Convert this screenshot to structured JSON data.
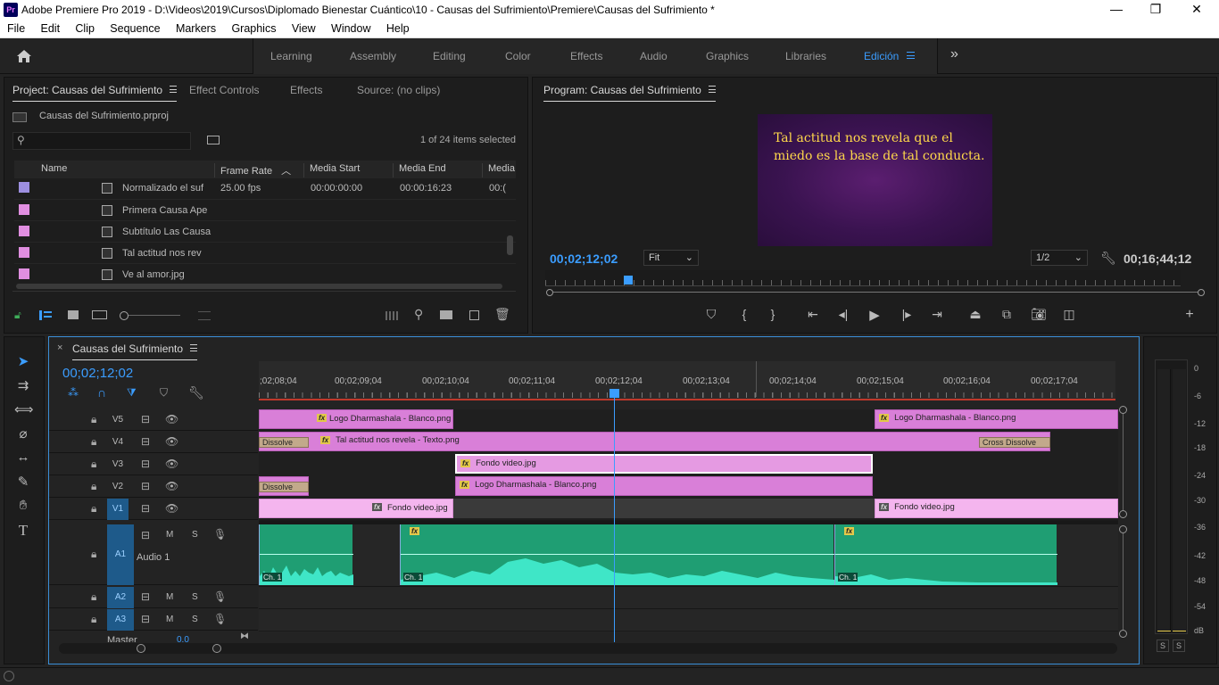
{
  "window": {
    "title": "Adobe Premiere Pro 2019 - D:\\Videos\\2019\\Cursos\\Diplomado Bienestar Cuántico\\10 - Causas del Sufrimiento\\Premiere\\Causas del Sufrimiento *",
    "logo": "Pr",
    "controls": [
      "—",
      "❐",
      "✕"
    ]
  },
  "menu": [
    "File",
    "Edit",
    "Clip",
    "Sequence",
    "Markers",
    "Graphics",
    "View",
    "Window",
    "Help"
  ],
  "workspaces": [
    "Learning",
    "Assembly",
    "Editing",
    "Color",
    "Effects",
    "Audio",
    "Graphics",
    "Libraries",
    "Edición"
  ],
  "workspace_more": "»",
  "project_panel": {
    "tabs": [
      "Project: Causas del Sufrimiento",
      "Effect Controls",
      "Effects",
      "Source: (no clips)"
    ],
    "file": "Causas del Sufrimiento.prproj",
    "search_placeholder": "",
    "items_selected": "1 of 24 items selected",
    "columns": [
      "Name",
      "Frame Rate",
      "Media Start",
      "Media End",
      "Media"
    ],
    "rows": [
      {
        "name": "Normalizado el suf",
        "frame_rate": "25.00 fps",
        "media_start": "00:00:00:00",
        "media_end": "00:00:16:23",
        "media": "00:(",
        "color": "#9d8fe0"
      },
      {
        "name": "Primera Causa Ape",
        "frame_rate": "",
        "media_start": "",
        "media_end": "",
        "media": "",
        "color": "#e08ee0"
      },
      {
        "name": "Subtítulo Las Causa",
        "frame_rate": "",
        "media_start": "",
        "media_end": "",
        "media": "",
        "color": "#e08ee0"
      },
      {
        "name": "Tal actitud nos rev",
        "frame_rate": "",
        "media_start": "",
        "media_end": "",
        "media": "",
        "color": "#e08ee0"
      },
      {
        "name": "Ve al amor.jpg",
        "frame_rate": "",
        "media_start": "",
        "media_end": "",
        "media": "",
        "color": "#e08ee0"
      }
    ]
  },
  "program_monitor": {
    "title": "Program: Causas del Sufrimiento",
    "frame_text": "Tal actitud nos revela que el miedo es la base de tal conducta.",
    "current_tc": "00;02;12;02",
    "duration_tc": "00;16;44;12",
    "zoom": "Fit",
    "resolution": "1/2",
    "playhead_fraction": 0.13
  },
  "timeline": {
    "title": "Causas del Sufrimiento",
    "timecode": "00;02;12;02",
    "ruler": ";02;08;04",
    "ruler_ticks": [
      "00;02;09;04",
      "00;02;10;04",
      "00;02;11;04",
      "00;02;12;04",
      "00;02;13;04",
      "00;02;14;04",
      "00;02;15;04",
      "00;02;16;04",
      "00;02;17;04"
    ],
    "video_tracks": [
      "V5",
      "V4",
      "V3",
      "V2",
      "V1"
    ],
    "audio_tracks": [
      {
        "id": "A1",
        "name": "Audio 1"
      },
      {
        "id": "A2",
        "name": ""
      },
      {
        "id": "A3",
        "name": ""
      }
    ],
    "master": {
      "label": "Master",
      "value": "0.0"
    },
    "track_buttons": {
      "mute": "M",
      "solo": "S"
    },
    "clips": {
      "v5a": "Logo Dharmashala - Blanco.png",
      "v5b": "Logo Dharmashala - Blanco.png",
      "v4_trans_a": "Dissolve",
      "v4": "Tal actitud nos revela - Texto.png",
      "v4_trans_b": "Cross Dissolve",
      "v3": "Fondo video.jpg",
      "v2_trans": "Dissolve",
      "v2": "Logo Dharmashala - Blanco.png",
      "v1a": "Fondo video.jpg",
      "v1b": "Fondo video.jpg",
      "fx": "fx",
      "channel": "Ch. 1"
    }
  },
  "audio_meter": {
    "scale": [
      "0",
      "-6",
      "-12",
      "-18",
      "-24",
      "-30",
      "-36",
      "-42",
      "-48",
      "-54",
      "dB"
    ],
    "solo_buttons": [
      "S",
      "S"
    ]
  },
  "colors": {
    "accent": "#3b9dff",
    "video_clip": "#d97fd8",
    "audio_clip": "#1f9e73",
    "playhead": "#3b9dff"
  }
}
